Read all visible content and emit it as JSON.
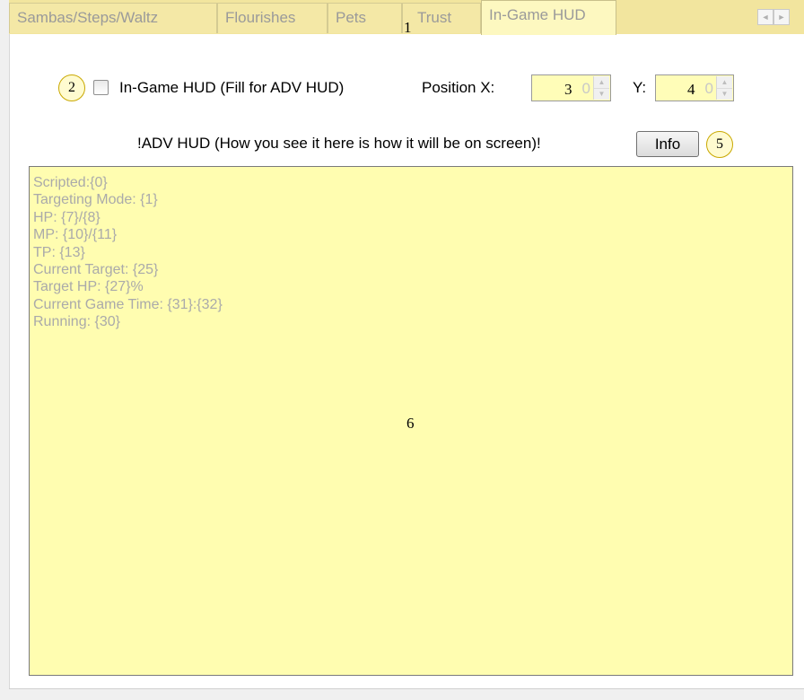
{
  "tabs": [
    {
      "label": "Sambas/Steps/Waltz",
      "active": false
    },
    {
      "label": "Flourishes",
      "active": false
    },
    {
      "label": "Pets",
      "active": false
    },
    {
      "label": "Trust",
      "active": false
    },
    {
      "label": "In-Game HUD",
      "active": true
    }
  ],
  "tab_scroll": {
    "left": "◄",
    "right": "►"
  },
  "hud": {
    "checkbox_label": "In-Game HUD (Fill for ADV HUD)",
    "checkbox_checked": false,
    "position_x_label": "Position X:",
    "position_x_value": "0",
    "position_y_label": "Y:",
    "position_y_value": "0",
    "adv_label": "!ADV HUD (How you see it here is how it will be on screen)!",
    "info_button": "Info",
    "text_lines": [
      "Scripted:{0}",
      "Targeting Mode: {1}",
      "HP: {7}/{8}",
      "MP: {10}/{11}",
      "TP: {13}",
      "Current Target: {25}",
      "Target HP: {27}%",
      "Current Game Time: {31}:{32}",
      "Running: {30}"
    ]
  },
  "markers": [
    "1",
    "2",
    "3",
    "4",
    "5",
    "6"
  ],
  "colors": {
    "tab_strip": "#f2e59e",
    "input_background": "#fffdb8",
    "hud_background": "#fffdb0",
    "marker_border": "#c9a800"
  }
}
